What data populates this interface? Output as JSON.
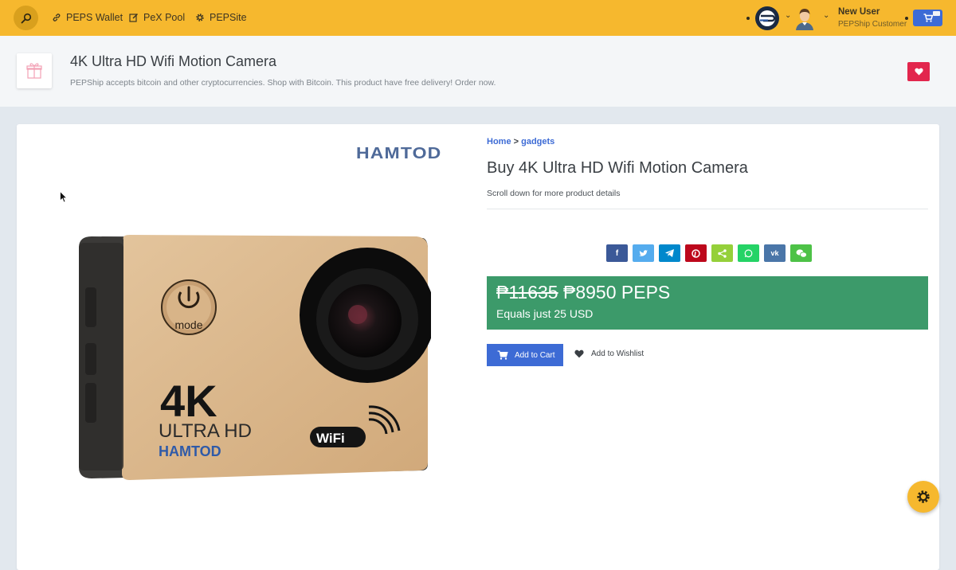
{
  "topbar": {
    "nav": [
      {
        "label": "PEPS Wallet",
        "icon": "link-icon"
      },
      {
        "label": "PeX Pool",
        "icon": "edit-icon"
      },
      {
        "label": "PEPSite",
        "icon": "gear-icon"
      }
    ],
    "user_name": "New User",
    "user_role": "PEPShip Customer"
  },
  "header": {
    "title": "4K Ultra HD Wifi Motion Camera",
    "subtitle": "PEPShip accepts bitcoin and other cryptocurrencies. Shop with Bitcoin. This product have free delivery! Order now."
  },
  "product": {
    "brand": "HAMTOD",
    "breadcrumb": {
      "home": "Home",
      "separator": ">",
      "category": "gadgets"
    },
    "title": "Buy 4K Ultra HD Wifi Motion Camera",
    "note": "Scroll down for more product details",
    "old_price": "₱11635",
    "price": "₱8950 PEPS",
    "usd": "Equals just 25 USD",
    "add_to_cart": "Add to Cart",
    "add_to_wishlist": "Add to Wishlist"
  },
  "share": [
    {
      "name": "facebook",
      "color": "#3b5998"
    },
    {
      "name": "twitter",
      "color": "#55acee"
    },
    {
      "name": "telegram",
      "color": "#0088cc"
    },
    {
      "name": "pinterest",
      "color": "#bd081c"
    },
    {
      "name": "sharethis",
      "color": "#95d03a"
    },
    {
      "name": "whatsapp",
      "color": "#25d366"
    },
    {
      "name": "vk",
      "color": "#4a76a8"
    },
    {
      "name": "wechat",
      "color": "#4dc247"
    }
  ],
  "colors": {
    "accent": "#f6b82e",
    "primary": "#3d6bd5",
    "price_bg": "#3c9a6a",
    "heart": "#e2264d"
  }
}
